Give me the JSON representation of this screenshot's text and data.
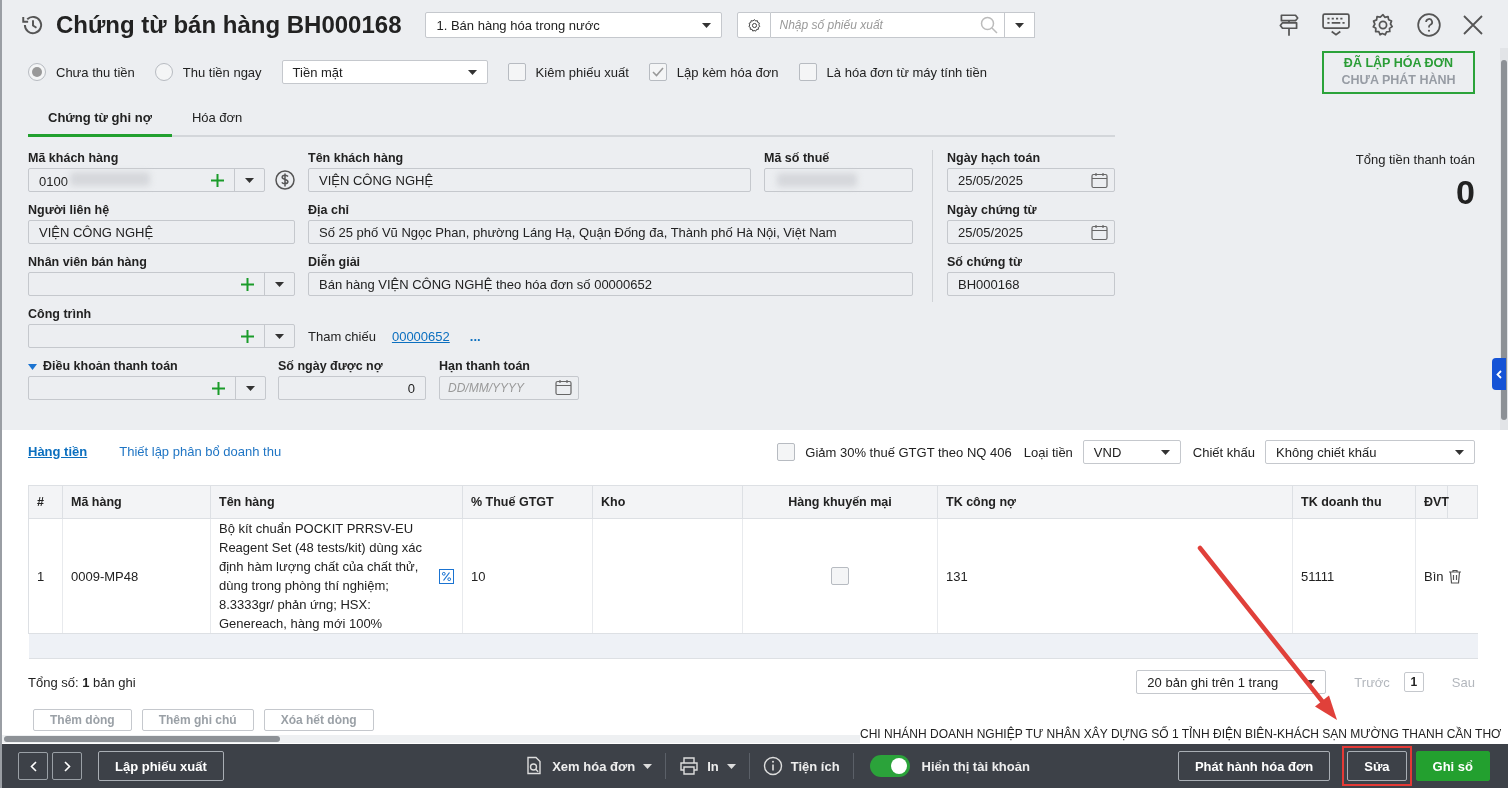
{
  "title": "Chứng từ bán hàng BH000168",
  "sale_type": {
    "value": "1. Bán hàng hóa trong nước"
  },
  "search": {
    "placeholder": "Nhập số phiếu xuất"
  },
  "payment_options": [
    {
      "label": "Chưa thu tiền",
      "selected": true
    },
    {
      "label": "Thu tiền ngay",
      "selected": false
    }
  ],
  "payment_method": {
    "value": "Tiền mặt"
  },
  "options": [
    {
      "label": "Kiêm phiếu xuất",
      "checked": false
    },
    {
      "label": "Lập kèm hóa đơn",
      "checked": true
    },
    {
      "label": "Là hóa đơn từ máy tính tiền",
      "checked": false
    }
  ],
  "status": {
    "line_1": "ĐÃ LẬP HÓA ĐƠN",
    "line_2": "CHƯA PHÁT HÀNH"
  },
  "tabs": [
    {
      "label": "Chứng từ ghi nợ",
      "selected": true
    },
    {
      "label": "Hóa đơn",
      "selected": false
    }
  ],
  "customer_code": {
    "label": "Mã khách hàng",
    "value": "0100"
  },
  "customer_name": {
    "label": "Tên khách hàng",
    "value": "VIỆN CÔNG NGHỆ"
  },
  "tax_code": {
    "label": "Mã số thuế"
  },
  "contact": {
    "label": "Người liên hệ",
    "value": "VIỆN CÔNG NGHỆ"
  },
  "address": {
    "label": "Địa chỉ",
    "value": "Số 25 phố Vũ Ngọc Phan, phường Láng Hạ, Quận Đống đa, Thành phố Hà Nội, Việt Nam"
  },
  "salesperson": {
    "label": "Nhân viên bán hàng"
  },
  "description": {
    "label": "Diễn giải",
    "value": "Bán hàng VIỆN CÔNG NGHỆ theo hóa đơn số 00000652"
  },
  "project": {
    "label": "Công trình"
  },
  "reference": {
    "label": "Tham chiếu",
    "link": "00000652",
    "more": "..."
  },
  "payment_terms": {
    "label": "Điều khoản thanh toán",
    "expanded": true
  },
  "credit_days": {
    "label": "Số ngày được nợ",
    "value": "0"
  },
  "due_date": {
    "label": "Hạn thanh toán",
    "placeholder": "DD/MM/YYYY"
  },
  "posting_date": {
    "label": "Ngày hạch toán",
    "value": "25/05/2025"
  },
  "voucher_date": {
    "label": "Ngày chứng từ",
    "value": "25/05/2025"
  },
  "voucher_no": {
    "label": "Số chứng từ",
    "value": "BH000168"
  },
  "total": {
    "label": "Tổng tiền thanh toán",
    "value": "0"
  },
  "detail_tabs": [
    {
      "label": "Hàng tiền",
      "selected": true
    },
    {
      "label": "Thiết lập phân bổ doanh thu",
      "selected": false
    }
  ],
  "vat_reduction": {
    "label": "Giảm 30% thuế GTGT theo NQ 406",
    "checked": false
  },
  "currency": {
    "label": "Loại tiền",
    "value": "VND"
  },
  "discount": {
    "label": "Chiết khấu",
    "value": "Không chiết khấu"
  },
  "table": {
    "columns": [
      "#",
      "Mã hàng",
      "Tên hàng",
      "% Thuế GTGT",
      "Kho",
      "Hàng khuyến mại",
      "TK công nợ",
      "TK doanh thu",
      "ĐVT"
    ],
    "rows": [
      {
        "no": "1",
        "code": "0009-MP48",
        "name": "Bộ kít chuẩn  POCKIT PRRSV-EU Reagent Set (48 tests/kit) dùng xác định hàm lượng chất của chất thử, dùng trong phòng thí nghiệm; 8.3333gr/ phản ứng; HSX: Genereach, hàng mới 100%",
        "vat": "10",
        "promotion": false,
        "debit_account": "131",
        "revenue_account": "51111",
        "unit": "Bìn"
      }
    ]
  },
  "record_count": "Tổng số: **1** bản ghi",
  "page_size": {
    "value": "20 bản ghi trên 1 trang"
  },
  "pager": {
    "prev": {
      "label": "Trước",
      "disabled": true
    },
    "page": "1",
    "next": {
      "label": "Sau",
      "disabled": true
    }
  },
  "row_buttons": [
    "Thêm dòng",
    "Thêm ghi chú",
    "Xóa hết dòng"
  ],
  "notice": "CHI NHÁNH DOANH NGHIỆP TƯ NHÂN XÂY DỰNG SỐ 1 TỈNH ĐIỆN BIÊN-KHÁCH SẠN MƯỜNG THANH CẦN THƠ",
  "footer": {
    "create_issue": "Lập phiếu xuất",
    "view_invoice": "Xem hóa đơn",
    "print": "In",
    "utilities": "Tiện ích",
    "show_accounts": {
      "label": "Hiển thị tài khoản",
      "on": true
    },
    "issue": "Phát hành hóa đơn",
    "edit": {
      "label": "Sửa",
      "highlighted": true
    },
    "post": "Ghi sổ"
  }
}
